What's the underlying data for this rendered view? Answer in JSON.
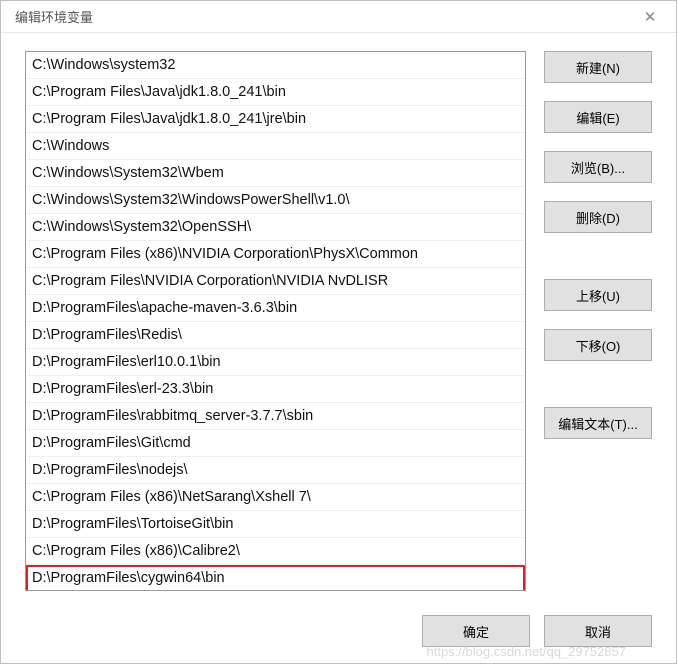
{
  "dialog": {
    "title": "编辑环境变量",
    "close_glyph": "✕"
  },
  "path_list": {
    "items": [
      "C:\\Windows\\system32",
      "C:\\Program Files\\Java\\jdk1.8.0_241\\bin",
      "C:\\Program Files\\Java\\jdk1.8.0_241\\jre\\bin",
      "C:\\Windows",
      "C:\\Windows\\System32\\Wbem",
      "C:\\Windows\\System32\\WindowsPowerShell\\v1.0\\",
      "C:\\Windows\\System32\\OpenSSH\\",
      "C:\\Program Files (x86)\\NVIDIA Corporation\\PhysX\\Common",
      "C:\\Program Files\\NVIDIA Corporation\\NVIDIA NvDLISR",
      "D:\\ProgramFiles\\apache-maven-3.6.3\\bin",
      "D:\\ProgramFiles\\Redis\\",
      "D:\\ProgramFiles\\erl10.0.1\\bin",
      "D:\\ProgramFiles\\erl-23.3\\bin",
      "D:\\ProgramFiles\\rabbitmq_server-3.7.7\\sbin",
      "D:\\ProgramFiles\\Git\\cmd",
      "D:\\ProgramFiles\\nodejs\\",
      "C:\\Program Files (x86)\\NetSarang\\Xshell 7\\",
      "D:\\ProgramFiles\\TortoiseGit\\bin",
      "C:\\Program Files (x86)\\Calibre2\\",
      "D:\\ProgramFiles\\cygwin64\\bin"
    ],
    "highlighted_index": 19
  },
  "buttons": {
    "new": "新建(N)",
    "edit": "编辑(E)",
    "browse": "浏览(B)...",
    "delete": "删除(D)",
    "move_up": "上移(U)",
    "move_down": "下移(O)",
    "edit_text": "编辑文本(T)..."
  },
  "footer": {
    "ok": "确定",
    "cancel": "取消"
  },
  "watermark": "https://blog.csdn.net/qq_29752857"
}
